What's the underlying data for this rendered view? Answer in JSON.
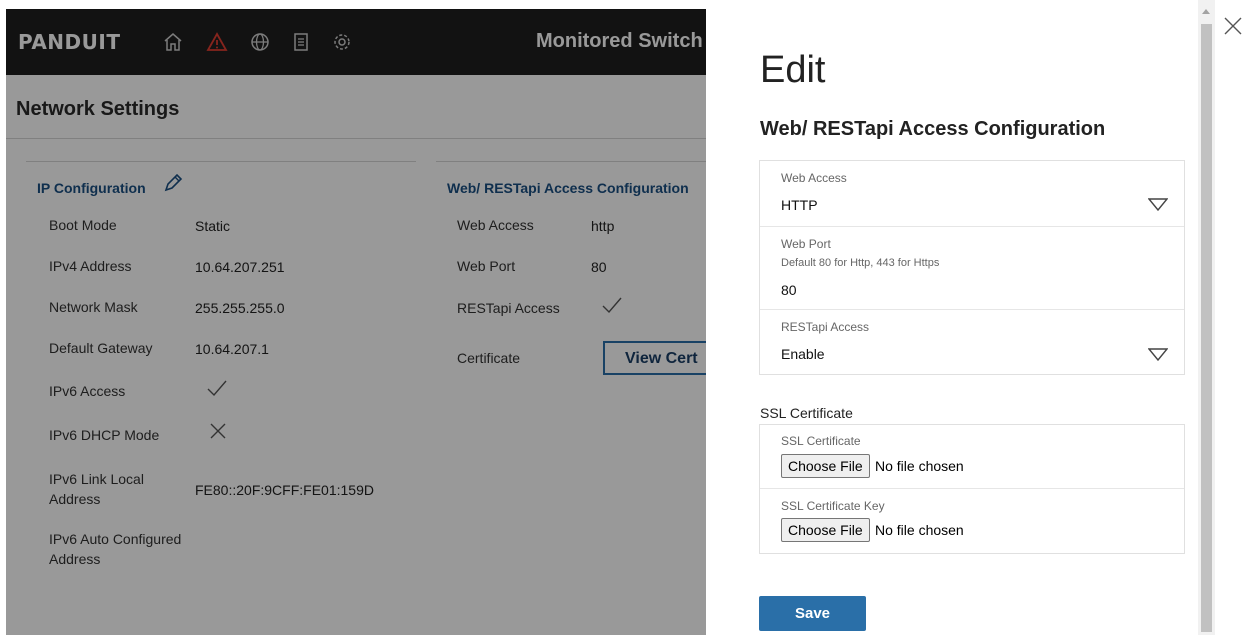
{
  "app": {
    "logo": "PANDUIT",
    "title": "Monitored Switch",
    "nav_icons": [
      "home-icon",
      "alert-icon",
      "globe-icon",
      "document-icon",
      "gear-icon"
    ]
  },
  "page": {
    "title": "Network Settings"
  },
  "ip_config": {
    "title": "IP Configuration",
    "rows": [
      {
        "label": "Boot Mode",
        "value": "Static"
      },
      {
        "label": "IPv4 Address",
        "value": "10.64.207.251"
      },
      {
        "label": "Network Mask",
        "value": "255.255.255.0"
      },
      {
        "label": "Default Gateway",
        "value": "10.64.207.1"
      },
      {
        "label": "IPv6 Access",
        "value": "check-icon"
      },
      {
        "label": "IPv6 DHCP Mode",
        "value": "cross-icon"
      },
      {
        "label": "IPv6 Link Local Address",
        "value": "FE80::20F:9CFF:FE01:159D"
      },
      {
        "label": "IPv6 Auto Configured Address",
        "value": ""
      }
    ]
  },
  "web_config": {
    "title": "Web/ RESTapi Access Configuration",
    "rows": [
      {
        "label": "Web Access",
        "value": "http"
      },
      {
        "label": "Web Port",
        "value": "80"
      },
      {
        "label": "RESTapi Access",
        "value": "check-icon"
      },
      {
        "label": "Certificate",
        "value": ""
      }
    ],
    "view_cert_label": "View Cert"
  },
  "panel": {
    "title": "Edit",
    "subtitle": "Web/ RESTapi Access Configuration",
    "web_access": {
      "label": "Web Access",
      "value": "HTTP"
    },
    "web_port": {
      "label": "Web Port",
      "hint": "Default 80 for Http, 443 for Https",
      "value": "80"
    },
    "restapi_access": {
      "label": "RESTapi Access",
      "value": "Enable"
    },
    "ssl": {
      "heading": "SSL Certificate",
      "cert": {
        "label": "SSL Certificate",
        "button": "Choose File",
        "status": "No file chosen"
      },
      "key": {
        "label": "SSL Certificate Key",
        "button": "Choose File",
        "status": "No file chosen"
      }
    },
    "save_label": "Save"
  },
  "colors": {
    "accent": "#2a6fa8",
    "section_title": "#1a4f82",
    "alert": "#e03c31",
    "topbar": "#1f1f1f"
  }
}
